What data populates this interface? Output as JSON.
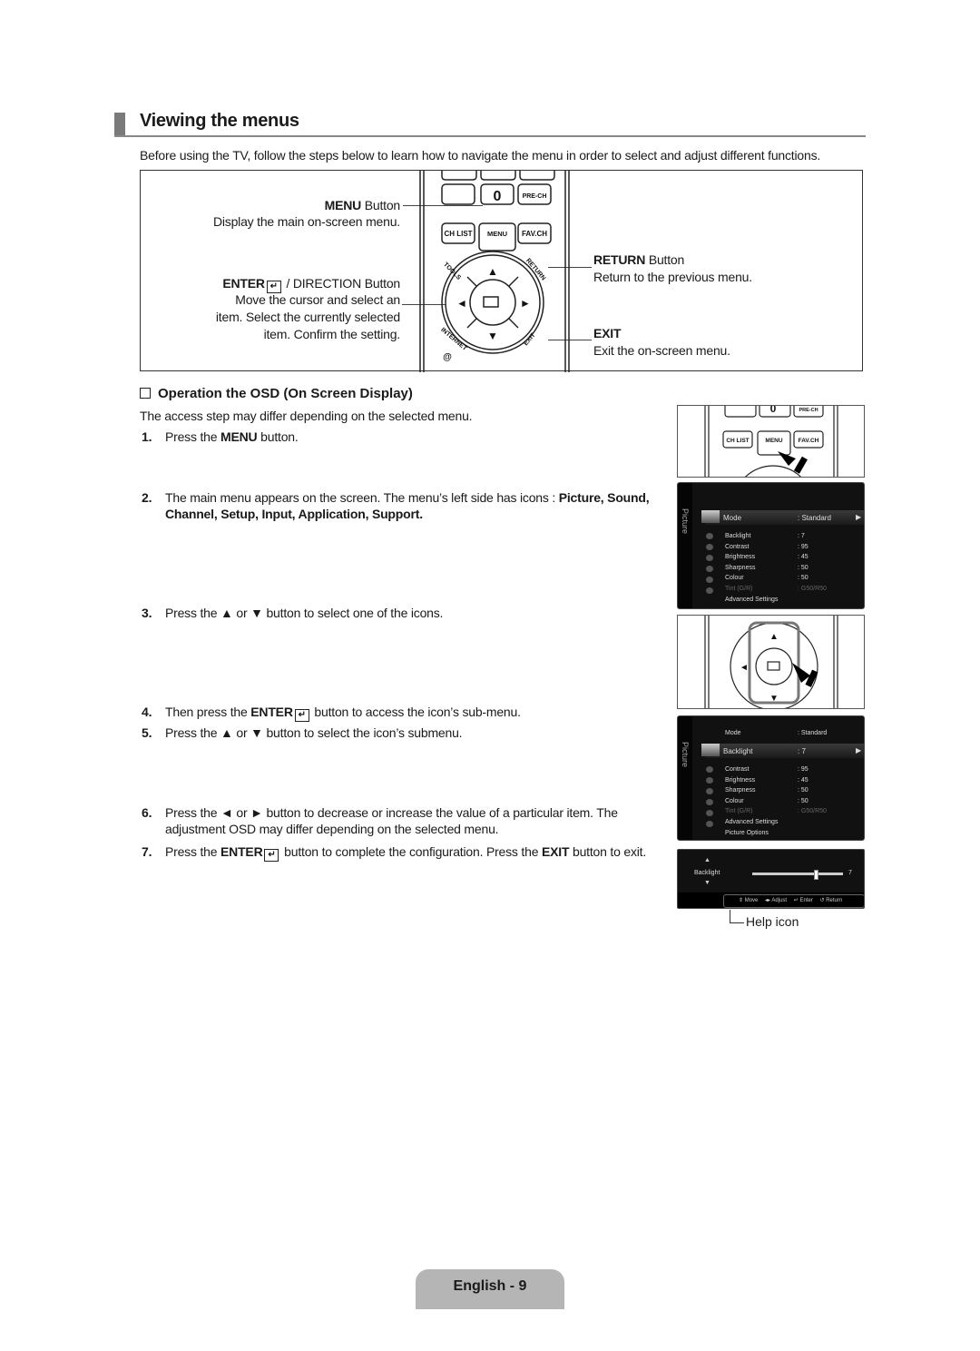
{
  "page": {
    "title": "Viewing the menus",
    "intro": "Before using the TV, follow the steps below to learn how to navigate the menu in order to select and adjust different functions.",
    "footer": "English - 9"
  },
  "remote_diagram": {
    "menu_button": {
      "label_bold": "MENU",
      "label_rest": " Button",
      "desc": "Display the main on-screen menu."
    },
    "enter_button": {
      "label_bold": "ENTER",
      "label_rest": " / DIRECTION Button",
      "desc_lines": [
        "Move the cursor and select an",
        "item. Select the currently selected",
        "item. Confirm the setting."
      ]
    },
    "return_button": {
      "label_bold": "RETURN",
      "label_rest": " Button",
      "desc": "Return to the previous menu."
    },
    "exit_button": {
      "label_bold": "EXIT",
      "desc": "Exit the on-screen menu."
    },
    "keys": {
      "zero": "0",
      "prech": "PRE-CH",
      "chlist": "CH LIST",
      "menu": "MENU",
      "favch": "FAV.CH",
      "tools": "TOOLS",
      "return": "RETURN",
      "internet": "INTERNET",
      "exit": "EXIT",
      "at": "@"
    }
  },
  "osd_section": {
    "heading": "Operation the OSD (On Screen Display)",
    "note": "The access step may differ depending on the selected menu.",
    "steps": [
      {
        "num": "1.",
        "pre": "Press the ",
        "bold": "MENU",
        "post": " button."
      },
      {
        "num": "2.",
        "pre": "The main menu appears on the screen. The menu’s left side has icons : ",
        "bold": "Picture, Sound,",
        "line2": "Channel, Setup, Input, Application, Support."
      },
      {
        "num": "3.",
        "text": "Press the ▲ or ▼ button to select one of the icons."
      },
      {
        "num": "4.",
        "pre": "Then press the ",
        "bold": "ENTER",
        "post": " button to access the icon’s sub-menu."
      },
      {
        "num": "5.",
        "text": "Press the ▲ or ▼ button to select the icon’s submenu."
      },
      {
        "num": "6.",
        "text": "Press the ◄ or ► button to decrease or increase the value of a particular item. The",
        "line2": "adjustment OSD may differ depending on the selected menu."
      },
      {
        "num": "7.",
        "pre": "Press the ",
        "bold": "ENTER",
        "post": " button to complete the configuration. Press the ",
        "bold2": "EXIT",
        "post2": " button to exit."
      }
    ]
  },
  "osd_menu_1": {
    "side_label": "Picture",
    "selected": {
      "label": "Mode",
      "value": ": Standard"
    },
    "rows": [
      {
        "label": "Backlight",
        "value": ": 7"
      },
      {
        "label": "Contrast",
        "value": ": 95"
      },
      {
        "label": "Brightness",
        "value": ": 45"
      },
      {
        "label": "Sharpness",
        "value": ": 50"
      },
      {
        "label": "Colour",
        "value": ": 50"
      },
      {
        "label": "Tint (G/R)",
        "value": ": G50/R50",
        "dim": true
      },
      {
        "label": "Advanced Settings",
        "value": ""
      }
    ]
  },
  "osd_menu_2": {
    "side_label": "Picture",
    "top": {
      "label": "Mode",
      "value": ": Standard"
    },
    "selected": {
      "label": "Backlight",
      "value": ": 7"
    },
    "rows": [
      {
        "label": "Contrast",
        "value": ": 95"
      },
      {
        "label": "Brightness",
        "value": ": 45"
      },
      {
        "label": "Sharpness",
        "value": ": 50"
      },
      {
        "label": "Colour",
        "value": ": 50"
      },
      {
        "label": "Tint (G/R)",
        "value": ": G50/R50",
        "dim": true
      },
      {
        "label": "Advanced Settings",
        "value": ""
      },
      {
        "label": "Picture Options",
        "value": ""
      }
    ]
  },
  "adjust_osd": {
    "label": "Backlight",
    "value": "7",
    "slider_fraction": 0.7,
    "help": {
      "move": "Move",
      "adjust": "Adjust",
      "enter": "Enter",
      "return": "Return"
    },
    "callout": "Help icon"
  }
}
